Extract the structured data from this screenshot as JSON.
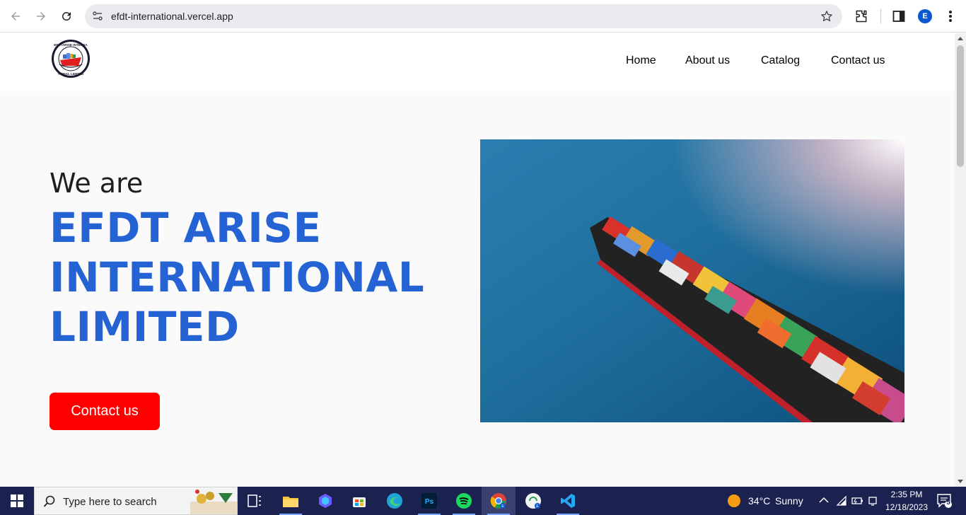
{
  "browser": {
    "url": "efdt-international.vercel.app",
    "profile_initial": "E"
  },
  "site": {
    "nav": [
      {
        "label": "Home"
      },
      {
        "label": "About us"
      },
      {
        "label": "Catalog"
      },
      {
        "label": "Contact us"
      }
    ],
    "hero": {
      "intro": "We are",
      "title": "EFDT ARISE INTERNATIONAL LIMITED",
      "cta_label": "Contact us"
    },
    "logo_text": "EFDTARISE INTERNATIONAL LIMITED",
    "colors": {
      "accent_blue": "#2563d4",
      "cta_red": "#ff0000"
    }
  },
  "taskbar": {
    "search_placeholder": "Type here to search",
    "weather": {
      "temp": "34°C",
      "condition": "Sunny"
    },
    "clock": {
      "time": "2:35 PM",
      "date": "12/18/2023"
    },
    "notification_count": "5",
    "apps": [
      "task-view",
      "file-explorer",
      "copilot",
      "microsoft-store",
      "edge",
      "photoshop",
      "spotify",
      "chrome",
      "chrome-profile",
      "vscode"
    ]
  }
}
